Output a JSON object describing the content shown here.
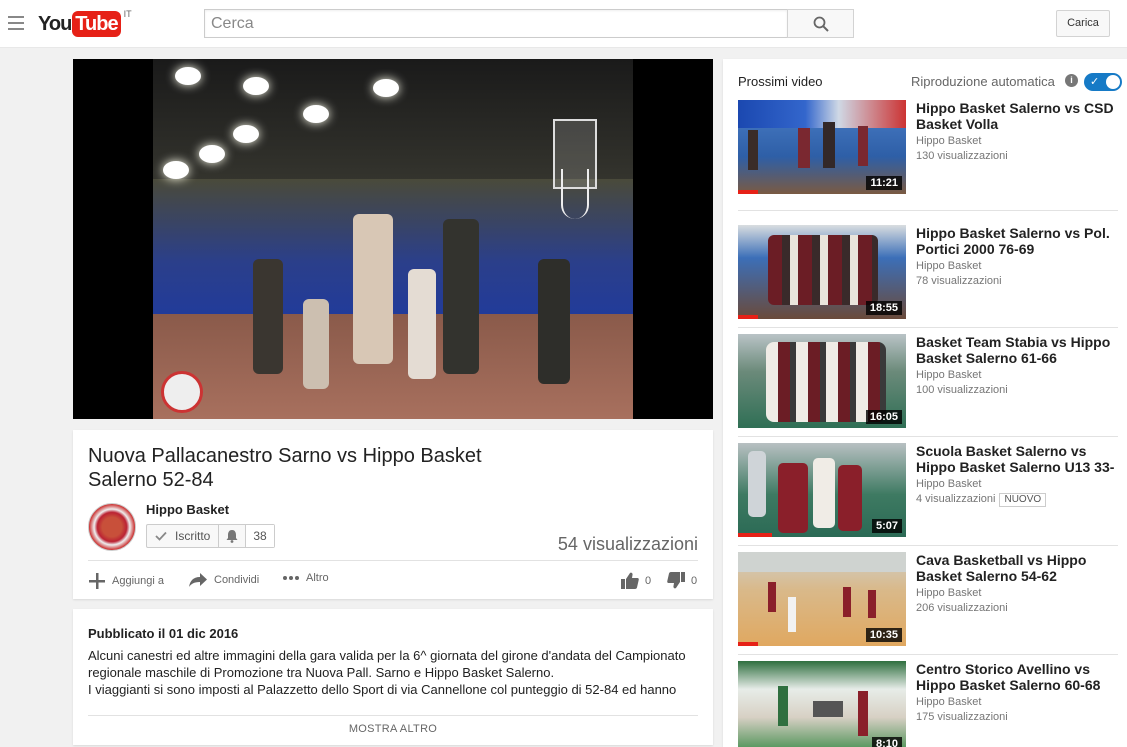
{
  "masthead": {
    "logo_you": "You",
    "logo_tube": "Tube",
    "country": "IT",
    "search_placeholder": "Cerca",
    "upload_label": "Carica"
  },
  "video": {
    "title": "Nuova Pallacanestro Sarno vs Hippo Basket Salerno 52-84",
    "channel": "Hippo Basket",
    "subscribed_label": "Iscritto",
    "subscriber_count": "38",
    "views": "54 visualizzazioni",
    "actions": {
      "add_to": "Aggiungi a",
      "share": "Condividi",
      "more": "Altro"
    },
    "likes": "0",
    "dislikes": "0"
  },
  "description": {
    "published": "Pubblicato il 01 dic 2016",
    "line1": "Alcuni canestri ed altre immagini della gara valida per la 6^ giornata del girone d'andata del Campionato",
    "line2": "regionale maschile di Promozione tra Nuova Pall. Sarno e Hippo Basket Salerno.",
    "line3": "I viaggianti si sono imposti al Palazzetto dello Sport di via Cannellone col punteggio di 52-84 ed hanno",
    "show_more": "MOSTRA ALTRO"
  },
  "sidebar": {
    "up_next": "Prossimi video",
    "autoplay": "Riproduzione automatica",
    "autoplay_on": true,
    "items": [
      {
        "title": "Hippo Basket Salerno vs CSD Basket Volla",
        "channel": "Hippo Basket",
        "views": "130 visualizzazioni",
        "duration": "11:21",
        "badge": "",
        "watched": 0.12
      },
      {
        "title": "Hippo Basket Salerno vs Pol. Portici 2000 76-69",
        "channel": "Hippo Basket",
        "views": "78 visualizzazioni",
        "duration": "18:55",
        "badge": "",
        "watched": 0.12
      },
      {
        "title": "Basket Team Stabia vs Hippo Basket Salerno 61-66",
        "channel": "Hippo Basket",
        "views": "100 visualizzazioni",
        "duration": "16:05",
        "badge": "",
        "watched": 0.0
      },
      {
        "title": "Scuola Basket Salerno vs Hippo Basket Salerno U13 33-",
        "channel": "Hippo Basket",
        "views": "4 visualizzazioni",
        "duration": "5:07",
        "badge": "NUOVO",
        "watched": 0.2
      },
      {
        "title": "Cava Basketball vs Hippo Basket Salerno 54-62",
        "channel": "Hippo Basket",
        "views": "206 visualizzazioni",
        "duration": "10:35",
        "badge": "",
        "watched": 0.12
      },
      {
        "title": "Centro Storico Avellino vs Hippo Basket Salerno 60-68",
        "channel": "Hippo Basket",
        "views": "175 visualizzazioni",
        "duration": "8:10",
        "badge": "",
        "watched": 0.0
      }
    ]
  },
  "colors": {
    "brand_red": "#e62117",
    "toggle_blue": "#167ac6"
  }
}
